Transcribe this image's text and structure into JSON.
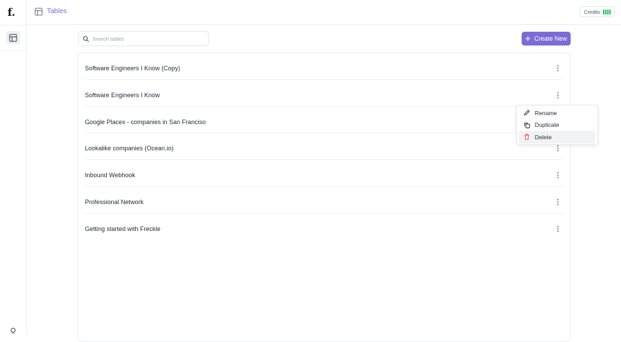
{
  "app": {
    "logo_text": "f."
  },
  "header": {
    "title": "Tables",
    "credits_label": "Credits"
  },
  "search": {
    "placeholder": "Search tables",
    "value": ""
  },
  "toolbar": {
    "create_label": "Create New"
  },
  "tables": [
    {
      "name": "Software Engineers I Know (Copy)"
    },
    {
      "name": "Software Engineers I Know"
    },
    {
      "name": "Google Places - companies in San Franciso"
    },
    {
      "name": "Lookalike companies (Ocean.io)"
    },
    {
      "name": "Inbound Webhook"
    },
    {
      "name": "Professional Network"
    },
    {
      "name": "Getting started with Freckle"
    }
  ],
  "context_menu": {
    "items": [
      {
        "label": "Rename",
        "icon": "pencil-icon"
      },
      {
        "label": "Duplicate",
        "icon": "copy-icon"
      },
      {
        "label": "Delete",
        "icon": "trash-icon",
        "color": "#ef4444"
      }
    ]
  },
  "colors": {
    "accent": "#7c6bd6",
    "credits": "#22c55e",
    "danger": "#ef4444"
  }
}
